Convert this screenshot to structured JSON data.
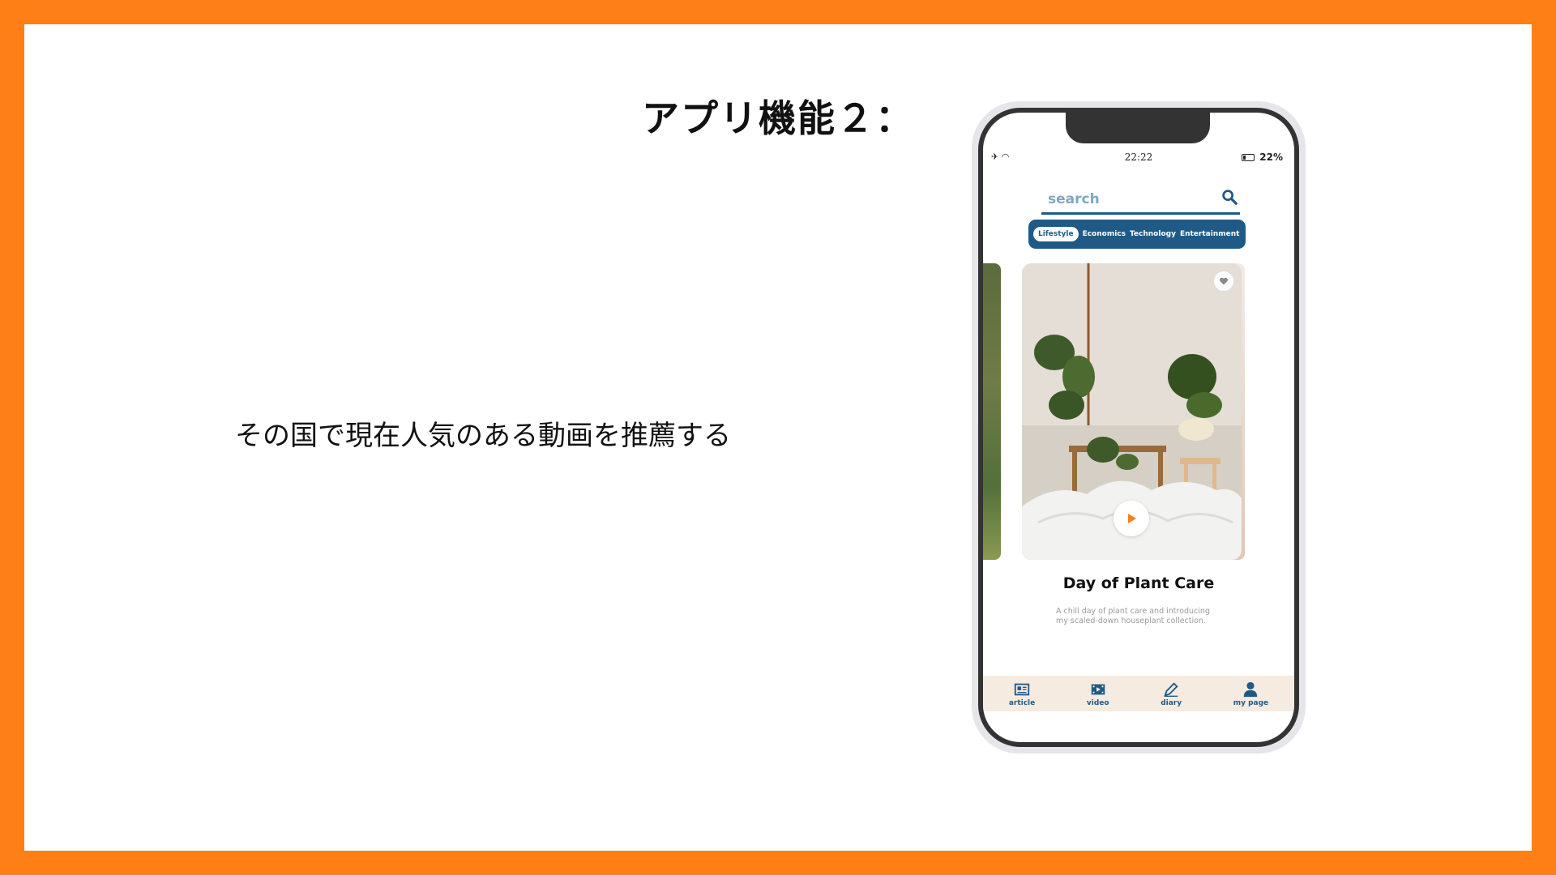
{
  "slide": {
    "title": "アプリ機能２：",
    "caption": "その国で現在人気のある動画を推薦する"
  },
  "phone": {
    "status": {
      "time": "22:22",
      "battery": "22%"
    },
    "search": {
      "placeholder": "search"
    },
    "tabs": [
      {
        "label": "Lifestyle",
        "active": true
      },
      {
        "label": "Economics",
        "active": false
      },
      {
        "label": "Technology",
        "active": false
      },
      {
        "label": "Entertainment",
        "active": false
      }
    ],
    "video": {
      "title": "Day of Plant Care",
      "description": "A chill day of plant care and introducing my scaled-down houseplant collection."
    },
    "nav": [
      {
        "label": "article",
        "icon": "newspaper-icon"
      },
      {
        "label": "video",
        "icon": "film-icon"
      },
      {
        "label": "diary",
        "icon": "pen-icon"
      },
      {
        "label": "my page",
        "icon": "person-icon"
      }
    ]
  },
  "colors": {
    "border": "#FF7F17",
    "accent": "#1F5A86",
    "nav_bg": "#F6EBE1"
  }
}
